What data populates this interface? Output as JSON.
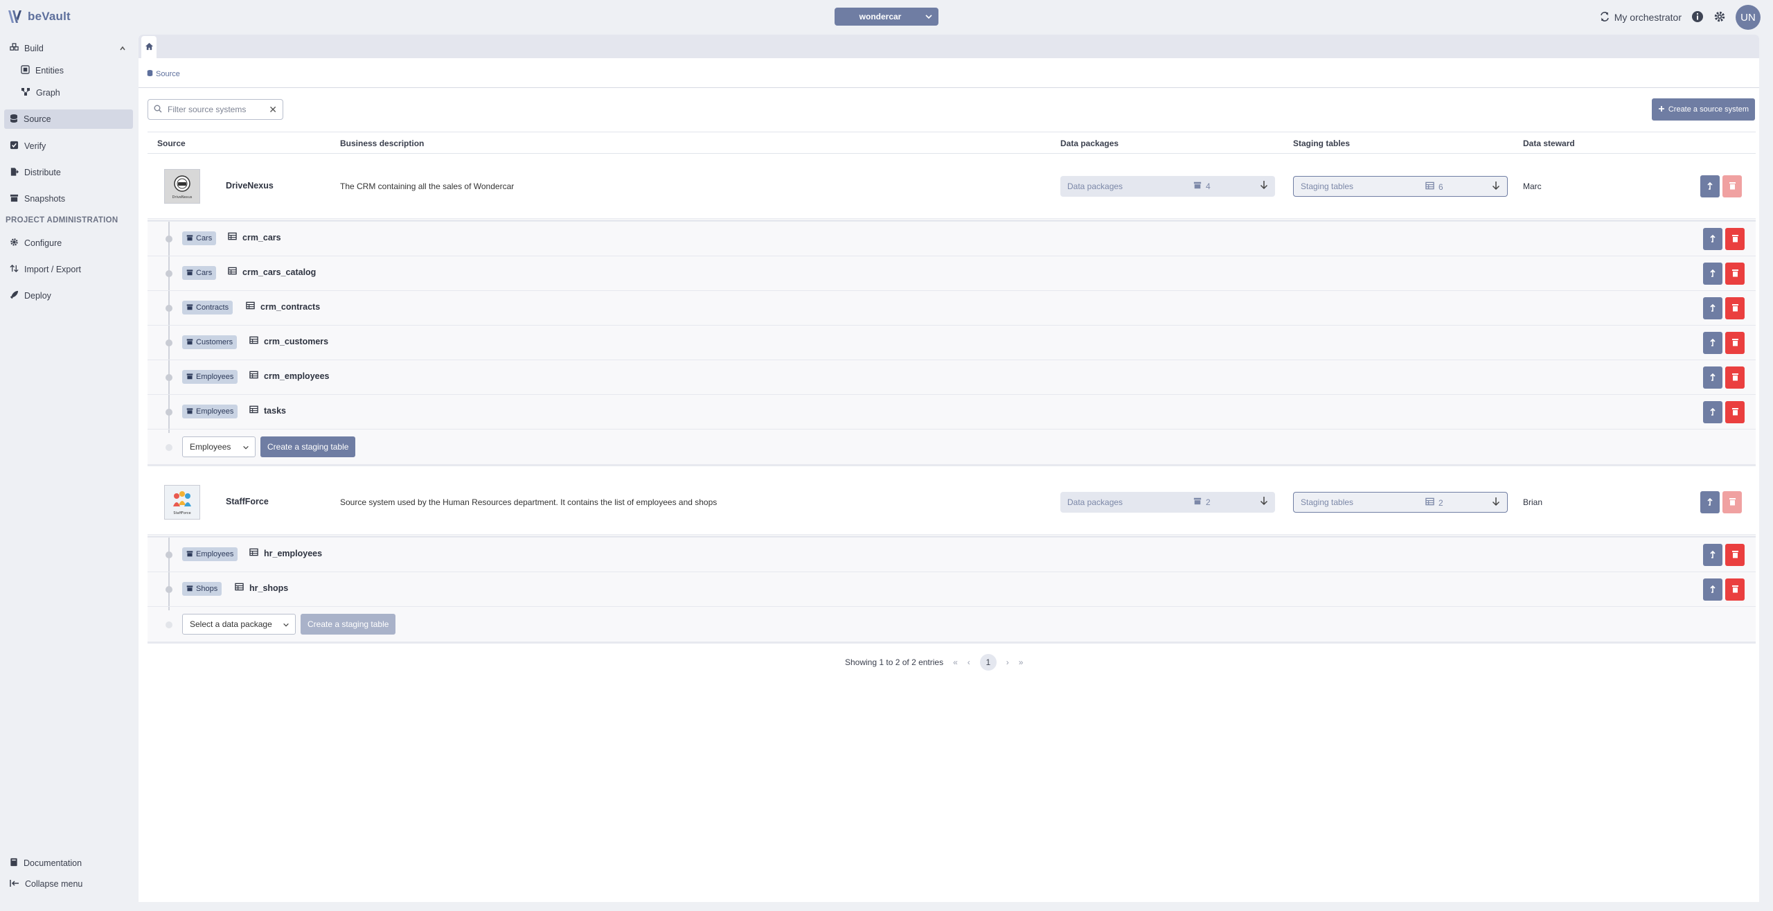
{
  "app": {
    "logo_text": "beVault"
  },
  "header": {
    "project": "wondercar",
    "orchestrator_label": "My orchestrator",
    "avatar_initials": "UN"
  },
  "sidebar": {
    "build": "Build",
    "entities": "Entities",
    "graph": "Graph",
    "source": "Source",
    "verify": "Verify",
    "distribute": "Distribute",
    "snapshots": "Snapshots",
    "section_admin": "PROJECT ADMINISTRATION",
    "configure": "Configure",
    "import_export": "Import / Export",
    "deploy": "Deploy",
    "documentation": "Documentation",
    "collapse": "Collapse menu"
  },
  "breadcrumb": {
    "label": "Source"
  },
  "toolbar": {
    "filter_placeholder": "Filter source systems",
    "create_source": "Create a source system"
  },
  "table": {
    "columns": {
      "source": "Source",
      "description": "Business description",
      "packages": "Data packages",
      "staging": "Staging tables",
      "steward": "Data steward"
    },
    "rows": [
      {
        "name": "DriveNexus",
        "image_caption": "DriveNexus",
        "description": "The CRM containing all the sales of Wondercar",
        "packages_label": "Data packages",
        "packages_count": "4",
        "staging_label": "Staging tables",
        "staging_count": "6",
        "steward": "Marc",
        "staging_tables": [
          {
            "package": "Cars",
            "table": "crm_cars"
          },
          {
            "package": "Cars",
            "table": "crm_cars_catalog"
          },
          {
            "package": "Contracts",
            "table": "crm_contracts"
          },
          {
            "package": "Customers",
            "table": "crm_customers"
          },
          {
            "package": "Employees",
            "table": "crm_employees"
          },
          {
            "package": "Employees",
            "table": "tasks"
          }
        ],
        "new_select_value": "Employees",
        "create_staging": "Create a staging table"
      },
      {
        "name": "StaffForce",
        "image_caption": "StaffForce",
        "description": "Source system used by the Human Resources department. It contains the list of employees and shops",
        "packages_label": "Data packages",
        "packages_count": "2",
        "staging_label": "Staging tables",
        "staging_count": "2",
        "steward": "Brian",
        "staging_tables": [
          {
            "package": "Employees",
            "table": "hr_employees"
          },
          {
            "package": "Shops",
            "table": "hr_shops"
          }
        ],
        "new_select_value": "Select a data package",
        "create_staging": "Create a staging table"
      }
    ]
  },
  "pagination": {
    "summary": "Showing 1 to 2 of 2 entries",
    "current_page": "1",
    "first": "«",
    "prev": "‹",
    "next": "›",
    "last": "»"
  },
  "colors": {
    "accent": "#6f7da3",
    "danger": "#ea3f3f",
    "badge": "#c9d3e3"
  }
}
